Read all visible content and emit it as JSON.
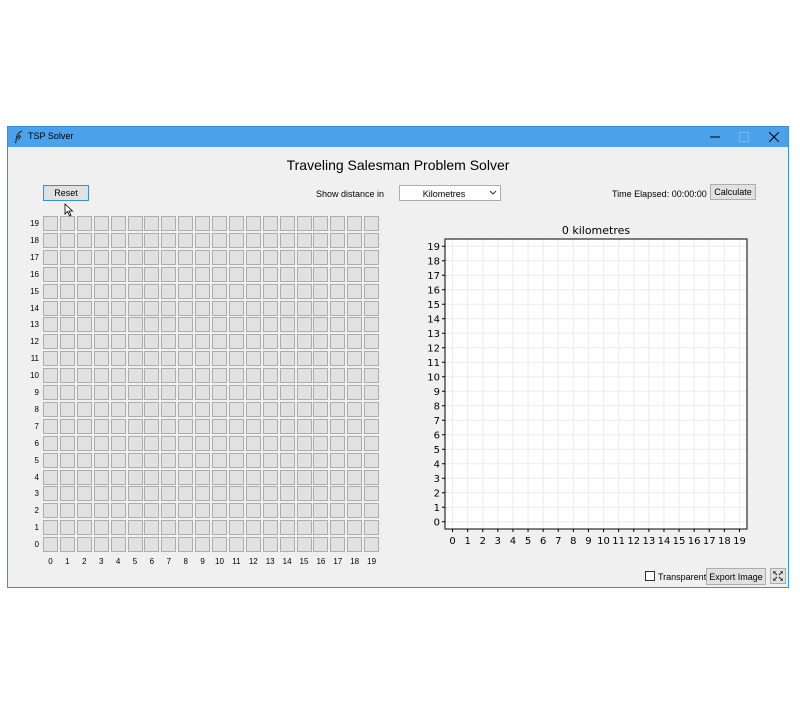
{
  "window": {
    "title": "TSP Solver"
  },
  "header": {
    "title": "Traveling Salesman Problem Solver"
  },
  "controls": {
    "reset_label": "Reset",
    "distance_label": "Show distance in",
    "distance_unit_selected": "Kilometres",
    "time_elapsed": "Time Elapsed: 00:00:00",
    "calculate_label": "Calculate"
  },
  "grid": {
    "rows": 20,
    "cols": 20,
    "x_labels": [
      "0",
      "1",
      "2",
      "3",
      "4",
      "5",
      "6",
      "7",
      "8",
      "9",
      "10",
      "11",
      "12",
      "13",
      "14",
      "15",
      "16",
      "17",
      "18",
      "19"
    ],
    "y_labels": [
      "19",
      "18",
      "17",
      "16",
      "15",
      "14",
      "13",
      "12",
      "11",
      "10",
      "9",
      "8",
      "7",
      "6",
      "5",
      "4",
      "3",
      "2",
      "1",
      "0"
    ]
  },
  "footer": {
    "transparent_label": "Transparent",
    "transparent_checked": false,
    "export_label": "Export Image"
  },
  "chart_data": {
    "type": "line",
    "title": "0 kilometres",
    "xlim": [
      -0.5,
      19.5
    ],
    "ylim": [
      -0.5,
      19.5
    ],
    "xticks": [
      0,
      1,
      2,
      3,
      4,
      5,
      6,
      7,
      8,
      9,
      10,
      11,
      12,
      13,
      14,
      15,
      16,
      17,
      18,
      19
    ],
    "yticks": [
      0,
      1,
      2,
      3,
      4,
      5,
      6,
      7,
      8,
      9,
      10,
      11,
      12,
      13,
      14,
      15,
      16,
      17,
      18,
      19
    ],
    "grid": true,
    "series": []
  },
  "colors": {
    "titlebar": "#4ba1ea",
    "cell": "#e1e1e1",
    "cell_border": "#adadad"
  }
}
